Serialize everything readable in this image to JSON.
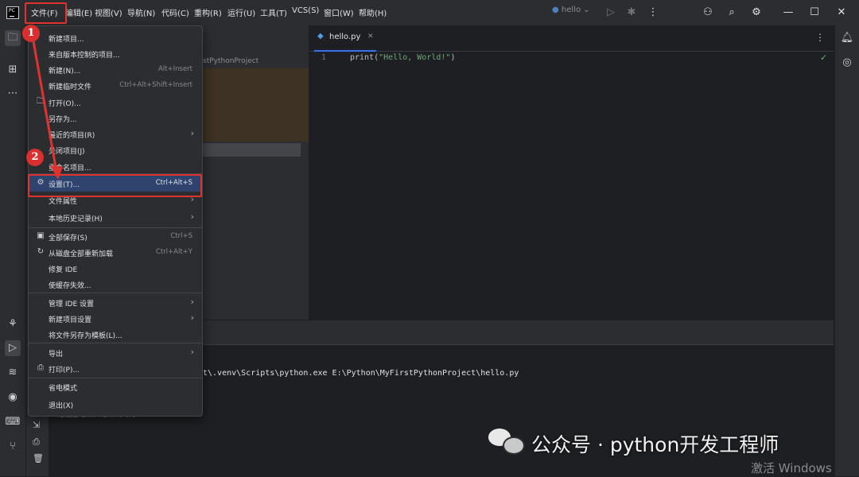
{
  "titlebar": {
    "menus": [
      "文件(F)",
      "编辑(E)",
      "视图(V)",
      "导航(N)",
      "代码(C)",
      "重构(R)",
      "运行(U)",
      "工具(T)",
      "VCS(S)",
      "窗口(W)",
      "帮助(H)"
    ],
    "run_config": "hello",
    "icons": [
      "pycharm-logo",
      "play-icon",
      "debug-icon",
      "more-vert-icon",
      "add-user-icon",
      "search-icon",
      "settings-icon",
      "minimize-icon",
      "maximize-icon",
      "close-icon"
    ]
  },
  "left_strip_icons": [
    "folder-icon",
    "structure-icon",
    "more-horiz-icon",
    "python-console-icon",
    "run-icon",
    "layers-icon",
    "services-icon",
    "terminal-icon",
    "git-icon"
  ],
  "right_strip_icons": [
    "notifications-icon",
    "ai-assistant-icon"
  ],
  "project_panel": {
    "path_fragment": "stPythonProject"
  },
  "editor": {
    "tab_label": "hello.py",
    "line_number": "1",
    "code": "print(\"Hello, World!\")"
  },
  "run_panel": {
    "command_fragment": "t\\.venv\\Scripts\\python.exe E:\\Python\\MyFirstPythonProject\\hello.py",
    "exit_fragment": "进程已结束，退出代码为 0"
  },
  "file_menu": {
    "items": [
      {
        "label": "新建项目...",
        "shortcut": "",
        "arrow": false,
        "icon": ""
      },
      {
        "label": "来自版本控制的项目...",
        "shortcut": "",
        "arrow": false,
        "icon": ""
      },
      {
        "label": "新建(N)...",
        "shortcut": "Alt+Insert",
        "arrow": false,
        "icon": ""
      },
      {
        "label": "新建临时文件",
        "shortcut": "Ctrl+Alt+Shift+Insert",
        "arrow": false,
        "icon": ""
      },
      {
        "label": "打开(O)...",
        "shortcut": "",
        "arrow": false,
        "icon": "folder-icon"
      },
      {
        "label": "另存为...",
        "shortcut": "",
        "arrow": false,
        "icon": ""
      },
      {
        "label": "最近的项目(R)",
        "shortcut": "",
        "arrow": true,
        "icon": ""
      },
      {
        "label": "关闭项目(J)",
        "shortcut": "",
        "arrow": false,
        "icon": ""
      },
      {
        "label": "重命名项目...",
        "shortcut": "",
        "arrow": false,
        "icon": ""
      },
      {
        "label": "设置(T)...",
        "shortcut": "Ctrl+Alt+S",
        "arrow": false,
        "icon": "gear-icon"
      },
      {
        "label": "文件属性",
        "shortcut": "",
        "arrow": true,
        "icon": ""
      },
      {
        "label": "本地历史记录(H)",
        "shortcut": "",
        "arrow": true,
        "icon": ""
      },
      {
        "label": "全部保存(S)",
        "shortcut": "Ctrl+S",
        "arrow": false,
        "icon": "save-icon"
      },
      {
        "label": "从磁盘全部重新加载",
        "shortcut": "Ctrl+Alt+Y",
        "arrow": false,
        "icon": "reload-icon"
      },
      {
        "label": "修复 IDE",
        "shortcut": "",
        "arrow": false,
        "icon": ""
      },
      {
        "label": "使缓存失效...",
        "shortcut": "",
        "arrow": false,
        "icon": ""
      },
      {
        "label": "管理 IDE 设置",
        "shortcut": "",
        "arrow": true,
        "icon": ""
      },
      {
        "label": "新建项目设置",
        "shortcut": "",
        "arrow": true,
        "icon": ""
      },
      {
        "label": "将文件另存为模板(L)...",
        "shortcut": "",
        "arrow": false,
        "icon": ""
      },
      {
        "label": "导出",
        "shortcut": "",
        "arrow": true,
        "icon": ""
      },
      {
        "label": "打印(P)...",
        "shortcut": "",
        "arrow": false,
        "icon": "print-icon"
      },
      {
        "label": "省电模式",
        "shortcut": "",
        "arrow": false,
        "icon": ""
      },
      {
        "label": "退出(X)",
        "shortcut": "",
        "arrow": false,
        "icon": ""
      }
    ]
  },
  "callouts": [
    "1",
    "2"
  ],
  "watermark": {
    "text": "公众号 · python开发工程师",
    "activation": "激活 Windows"
  },
  "colors": {
    "accent_red": "#e0332f",
    "selection_blue": "#2e436e",
    "string_green": "#6aab73"
  }
}
